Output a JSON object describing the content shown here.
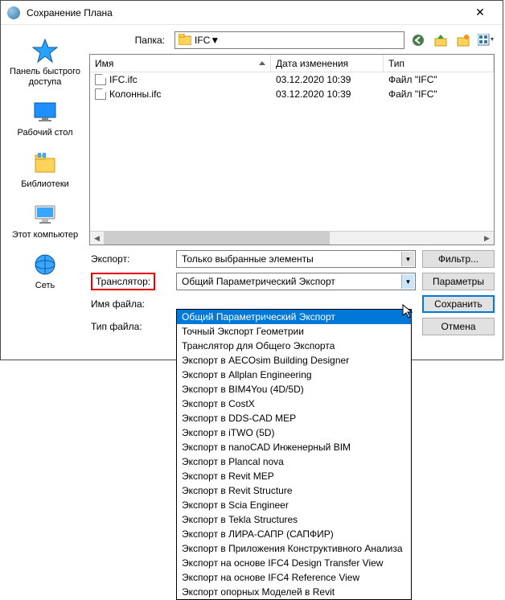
{
  "window": {
    "title": "Сохранение Плана"
  },
  "folder": {
    "label": "Папка:",
    "value": "IFC"
  },
  "sidebar": {
    "items": [
      {
        "label": "Панель быстрого\nдоступа"
      },
      {
        "label": "Рабочий стол"
      },
      {
        "label": "Библиотеки"
      },
      {
        "label": "Этот компьютер"
      },
      {
        "label": "Сеть"
      }
    ]
  },
  "filelist": {
    "headers": {
      "name": "Имя",
      "date": "Дата изменения",
      "type": "Тип"
    },
    "rows": [
      {
        "name": "IFC.ifc",
        "date": "03.12.2020 10:39",
        "type": "Файл \"IFC\""
      },
      {
        "name": "Колонны.ifc",
        "date": "03.12.2020 10:39",
        "type": "Файл \"IFC\""
      }
    ]
  },
  "controls": {
    "export_label": "Экспорт:",
    "export_value": "Только выбранные элементы",
    "translator_label": "Транслятор:",
    "translator_value": "Общий Параметрический Экспорт",
    "filename_label": "Имя файла:",
    "filetype_label": "Тип файла:",
    "filter_btn": "Фильтр...",
    "params_btn": "Параметры",
    "save_btn": "Сохранить",
    "cancel_btn": "Отмена"
  },
  "dropdown": {
    "options": [
      "Общий Параметрический Экспорт",
      "Точный Экспорт Геометрии",
      "Транслятор для Общего Экспорта",
      "Экспорт в AECOsim Building Designer",
      "Экспорт в Allplan Engineering",
      "Экспорт в BIM4You (4D/5D)",
      "Экспорт в CostX",
      "Экспорт в DDS-CAD MEP",
      "Экспорт в iTWO (5D)",
      "Экспорт в nanoCAD Инженерный BIM",
      "Экспорт в Plancal nova",
      "Экспорт в Revit MEP",
      "Экспорт в Revit Structure",
      "Экспорт в Scia Engineer",
      "Экспорт в Tekla Structures",
      "Экспорт в ЛИРА-САПР (САПФИР)",
      "Экспорт в Приложения Конструктивного Анализа",
      "Экспорт на основе IFC4 Design Transfer View",
      "Экспорт на основе IFC4 Reference View",
      "Экспорт опорных Моделей в Revit"
    ]
  }
}
